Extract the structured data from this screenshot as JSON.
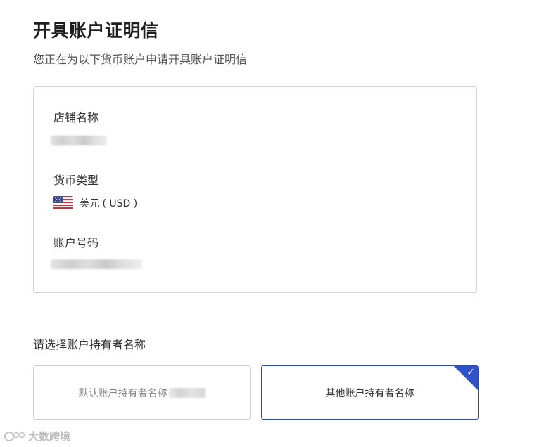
{
  "header": {
    "title": "开具账户证明信",
    "subtitle": "您正在为以下货币账户申请开具账户证明信"
  },
  "info_card": {
    "store_name_label": "店铺名称",
    "currency_type_label": "货币类型",
    "currency_value": "美元 ( USD )",
    "currency_flag_icon": "us-flag-icon",
    "account_number_label": "账户号码"
  },
  "holder_selection": {
    "label": "请选择账户持有者名称",
    "options": [
      {
        "label": "默认账户持有者名称",
        "selected": false
      },
      {
        "label": "其他账户持有者名称",
        "selected": true
      }
    ],
    "selected_icon": "checkmark-icon"
  },
  "watermark": {
    "text": "大数跨境",
    "logo_icon": "watermark-logo-icon"
  },
  "colors": {
    "accent": "#2d52c9",
    "selected_border": "#2b4ca8",
    "card_border": "#d4d4d4"
  }
}
